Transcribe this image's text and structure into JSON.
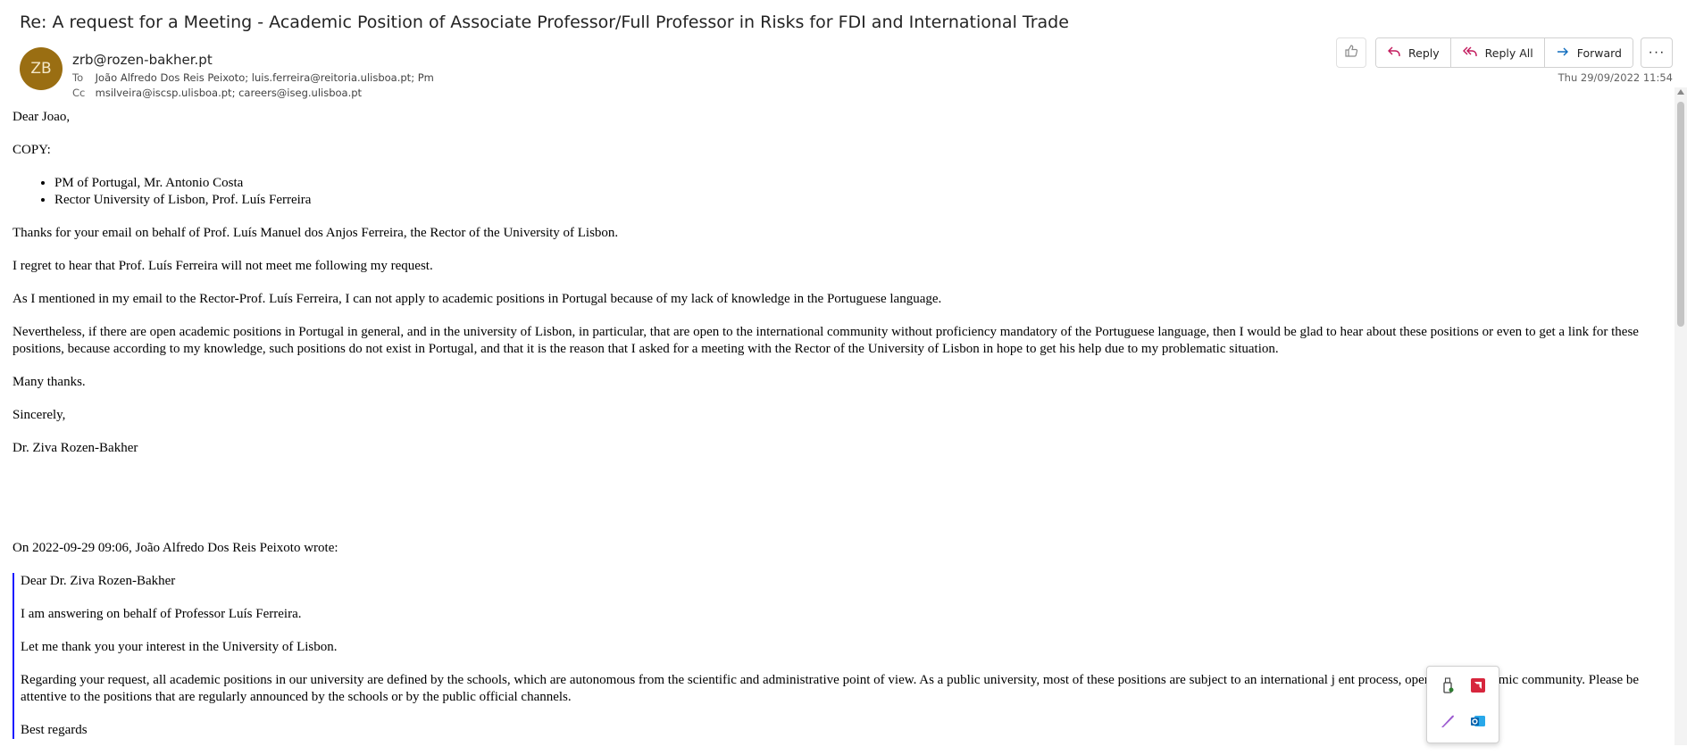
{
  "email": {
    "subject": "Re: A request for a Meeting - Academic Position of Associate Professor/Full Professor in Risks for FDI and International Trade",
    "avatar_initials": "ZB",
    "avatar_color": "#9a6e12",
    "from": "zrb@rozen-bakher.pt",
    "to_label": "To",
    "to": "João Alfredo Dos Reis Peixoto; luis.ferreira@reitoria.ulisboa.pt; Pm",
    "cc_label": "Cc",
    "cc": "msilveira@iscsp.ulisboa.pt; careers@iseg.ulisboa.pt",
    "date": "Thu 29/09/2022 11:54"
  },
  "toolbar": {
    "like_icon": "thumbs-up-icon",
    "reply_label": "Reply",
    "reply_all_label": "Reply All",
    "forward_label": "Forward",
    "more_label": "···",
    "accent": "#c2185b",
    "forward_accent": "#0f6cbd"
  },
  "body": {
    "greeting": "Dear Joao,",
    "copy_label": "COPY:",
    "copy_list": [
      "PM of Portugal, Mr. Antonio Costa",
      "Rector University of Lisbon, Prof. Luís Ferreira"
    ],
    "p1": "Thanks for your email on behalf of Prof. Luís Manuel dos Anjos Ferreira, the Rector of the University of Lisbon.",
    "p2": "I regret to hear that Prof. Luís Ferreira will not meet me following my request.",
    "p3": "As I mentioned in my email to the Rector-Prof. Luís Ferreira, I can not apply to academic positions in Portugal because of my lack of knowledge in the Portuguese language.",
    "p4": "Nevertheless, if there are open academic positions in Portugal in general, and in the university of Lisbon, in particular, that are open to the international community without proficiency mandatory of the Portuguese language, then I would be glad to hear about these positions or even to get a link for these positions, because according to my knowledge, such positions do not exist in Portugal, and that it is the reason that I asked for a meeting with the Rector of the University of Lisbon in hope to get his help due to my problematic situation.",
    "thanks": "Many thanks.",
    "closing": "Sincerely,",
    "signature": "Dr. Ziva Rozen-Bakher",
    "quote_header": "On 2022-09-29 09:06, João Alfredo Dos Reis Peixoto wrote:"
  },
  "quoted": {
    "greeting": "Dear Dr. Ziva Rozen-Bakher",
    "q1": "I am answering on behalf of Professor Luís Ferreira.",
    "q2": "Let me thank you your interest in the University of Lisbon.",
    "q3": "Regarding your request, all academic positions in our university are defined by the schools, which are autonomous from the scientific and administrative point of view. As a public university, most of these positions are subject to an international j                    ent process, open to the academic community. Please be attentive to the positions that are regularly announced by the schools or by the public official channels.",
    "q4": "Best regards"
  },
  "popup": {
    "icons": [
      "usb-drive-icon",
      "amd-icon",
      "pen-icon",
      "outlook-icon"
    ]
  }
}
